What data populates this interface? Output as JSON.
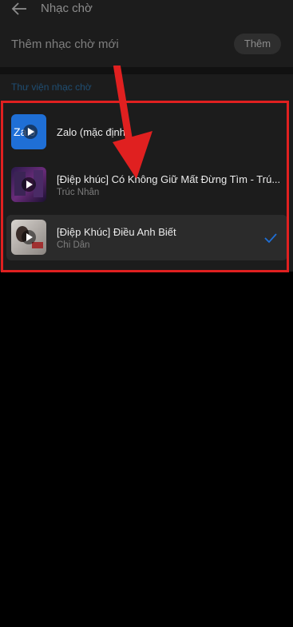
{
  "header": {
    "title": "Nhạc chờ"
  },
  "add_section": {
    "label": "Thêm nhạc chờ mới",
    "button": "Thêm"
  },
  "library": {
    "title": "Thư viện nhạc chờ",
    "items": [
      {
        "title": "Zalo (mặc định)",
        "artist": "",
        "thumb_text": "Zalo",
        "selected": false
      },
      {
        "title": "[Điệp khúc] Có Không Giữ Mất Đừng Tìm - Trú...",
        "artist": "Trúc Nhân",
        "selected": false
      },
      {
        "title": "[Điệp Khúc] Điều Anh Biết",
        "artist": "Chi Dân",
        "selected": true
      }
    ]
  },
  "colors": {
    "accent": "#1f6fd6",
    "annotation_red": "#e02020"
  },
  "icons": [
    "back-arrow-icon",
    "play-icon",
    "checkmark-icon"
  ]
}
